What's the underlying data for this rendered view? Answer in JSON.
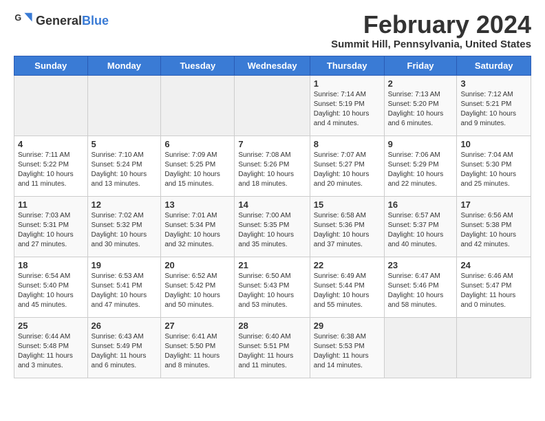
{
  "header": {
    "logo_general": "General",
    "logo_blue": "Blue",
    "month_title": "February 2024",
    "location": "Summit Hill, Pennsylvania, United States"
  },
  "days_of_week": [
    "Sunday",
    "Monday",
    "Tuesday",
    "Wednesday",
    "Thursday",
    "Friday",
    "Saturday"
  ],
  "weeks": [
    [
      {
        "day": "",
        "info": ""
      },
      {
        "day": "",
        "info": ""
      },
      {
        "day": "",
        "info": ""
      },
      {
        "day": "",
        "info": ""
      },
      {
        "day": "1",
        "info": "Sunrise: 7:14 AM\nSunset: 5:19 PM\nDaylight: 10 hours\nand 4 minutes."
      },
      {
        "day": "2",
        "info": "Sunrise: 7:13 AM\nSunset: 5:20 PM\nDaylight: 10 hours\nand 6 minutes."
      },
      {
        "day": "3",
        "info": "Sunrise: 7:12 AM\nSunset: 5:21 PM\nDaylight: 10 hours\nand 9 minutes."
      }
    ],
    [
      {
        "day": "4",
        "info": "Sunrise: 7:11 AM\nSunset: 5:22 PM\nDaylight: 10 hours\nand 11 minutes."
      },
      {
        "day": "5",
        "info": "Sunrise: 7:10 AM\nSunset: 5:24 PM\nDaylight: 10 hours\nand 13 minutes."
      },
      {
        "day": "6",
        "info": "Sunrise: 7:09 AM\nSunset: 5:25 PM\nDaylight: 10 hours\nand 15 minutes."
      },
      {
        "day": "7",
        "info": "Sunrise: 7:08 AM\nSunset: 5:26 PM\nDaylight: 10 hours\nand 18 minutes."
      },
      {
        "day": "8",
        "info": "Sunrise: 7:07 AM\nSunset: 5:27 PM\nDaylight: 10 hours\nand 20 minutes."
      },
      {
        "day": "9",
        "info": "Sunrise: 7:06 AM\nSunset: 5:29 PM\nDaylight: 10 hours\nand 22 minutes."
      },
      {
        "day": "10",
        "info": "Sunrise: 7:04 AM\nSunset: 5:30 PM\nDaylight: 10 hours\nand 25 minutes."
      }
    ],
    [
      {
        "day": "11",
        "info": "Sunrise: 7:03 AM\nSunset: 5:31 PM\nDaylight: 10 hours\nand 27 minutes."
      },
      {
        "day": "12",
        "info": "Sunrise: 7:02 AM\nSunset: 5:32 PM\nDaylight: 10 hours\nand 30 minutes."
      },
      {
        "day": "13",
        "info": "Sunrise: 7:01 AM\nSunset: 5:34 PM\nDaylight: 10 hours\nand 32 minutes."
      },
      {
        "day": "14",
        "info": "Sunrise: 7:00 AM\nSunset: 5:35 PM\nDaylight: 10 hours\nand 35 minutes."
      },
      {
        "day": "15",
        "info": "Sunrise: 6:58 AM\nSunset: 5:36 PM\nDaylight: 10 hours\nand 37 minutes."
      },
      {
        "day": "16",
        "info": "Sunrise: 6:57 AM\nSunset: 5:37 PM\nDaylight: 10 hours\nand 40 minutes."
      },
      {
        "day": "17",
        "info": "Sunrise: 6:56 AM\nSunset: 5:38 PM\nDaylight: 10 hours\nand 42 minutes."
      }
    ],
    [
      {
        "day": "18",
        "info": "Sunrise: 6:54 AM\nSunset: 5:40 PM\nDaylight: 10 hours\nand 45 minutes."
      },
      {
        "day": "19",
        "info": "Sunrise: 6:53 AM\nSunset: 5:41 PM\nDaylight: 10 hours\nand 47 minutes."
      },
      {
        "day": "20",
        "info": "Sunrise: 6:52 AM\nSunset: 5:42 PM\nDaylight: 10 hours\nand 50 minutes."
      },
      {
        "day": "21",
        "info": "Sunrise: 6:50 AM\nSunset: 5:43 PM\nDaylight: 10 hours\nand 53 minutes."
      },
      {
        "day": "22",
        "info": "Sunrise: 6:49 AM\nSunset: 5:44 PM\nDaylight: 10 hours\nand 55 minutes."
      },
      {
        "day": "23",
        "info": "Sunrise: 6:47 AM\nSunset: 5:46 PM\nDaylight: 10 hours\nand 58 minutes."
      },
      {
        "day": "24",
        "info": "Sunrise: 6:46 AM\nSunset: 5:47 PM\nDaylight: 11 hours\nand 0 minutes."
      }
    ],
    [
      {
        "day": "25",
        "info": "Sunrise: 6:44 AM\nSunset: 5:48 PM\nDaylight: 11 hours\nand 3 minutes."
      },
      {
        "day": "26",
        "info": "Sunrise: 6:43 AM\nSunset: 5:49 PM\nDaylight: 11 hours\nand 6 minutes."
      },
      {
        "day": "27",
        "info": "Sunrise: 6:41 AM\nSunset: 5:50 PM\nDaylight: 11 hours\nand 8 minutes."
      },
      {
        "day": "28",
        "info": "Sunrise: 6:40 AM\nSunset: 5:51 PM\nDaylight: 11 hours\nand 11 minutes."
      },
      {
        "day": "29",
        "info": "Sunrise: 6:38 AM\nSunset: 5:53 PM\nDaylight: 11 hours\nand 14 minutes."
      },
      {
        "day": "",
        "info": ""
      },
      {
        "day": "",
        "info": ""
      }
    ]
  ]
}
